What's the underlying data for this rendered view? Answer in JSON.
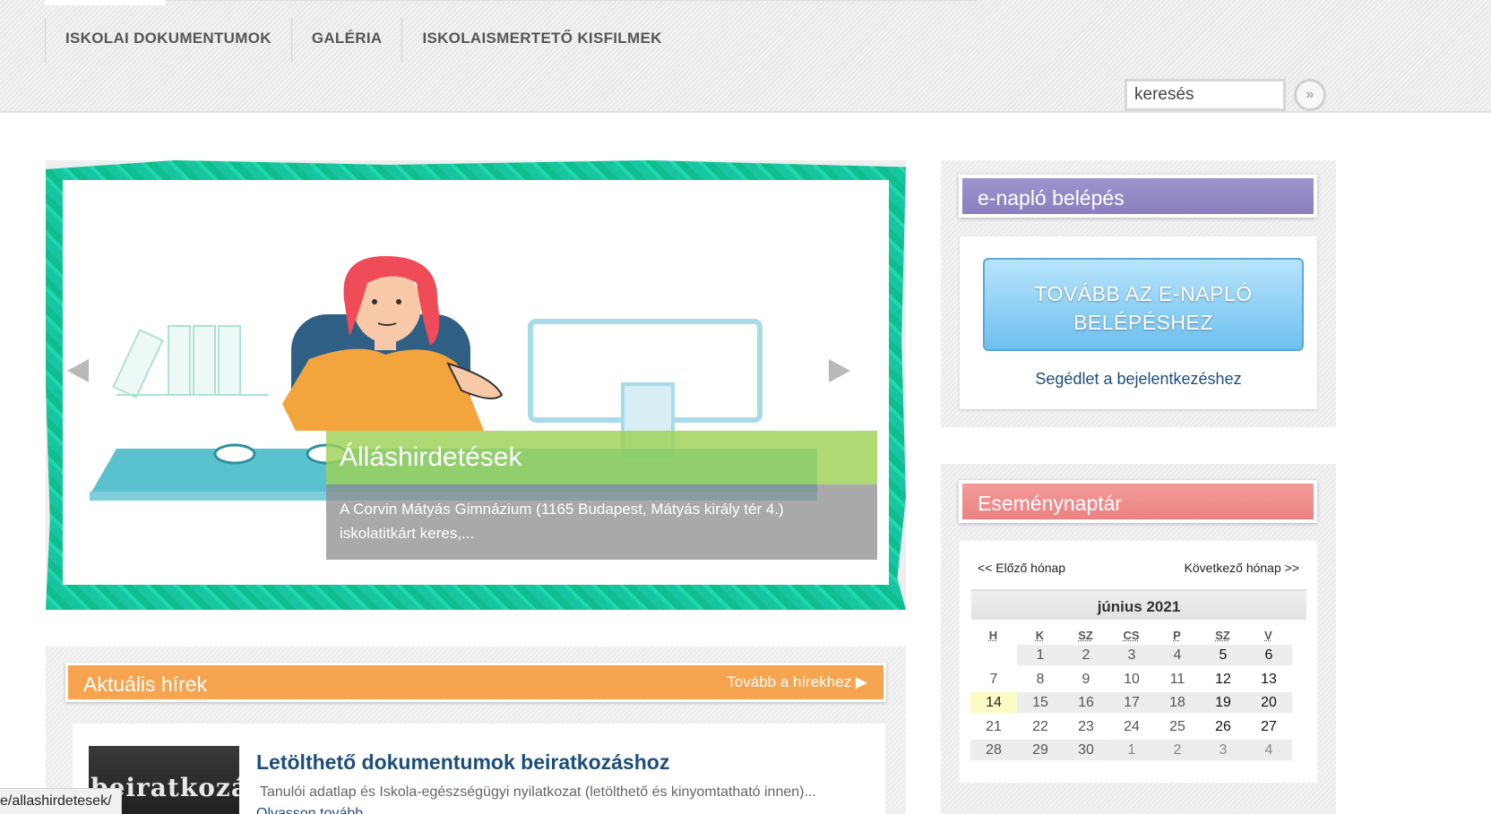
{
  "nav": {
    "items": [
      "ISKOLAI DOKUMENTUMOK",
      "GALÉRIA",
      "ISKOLAISMERTETŐ KISFILMEK"
    ]
  },
  "search": {
    "value": "keresés",
    "button_icon": "double-chevron-right-icon",
    "button_glyph": "»"
  },
  "slider": {
    "caption_title": "Álláshirdetések",
    "caption_text": "A Corvin Mátyás Gimnázium (1165 Budapest, Mátyás király tér 4.) iskolatitkárt keres,...",
    "colors": {
      "border": "#17c6a0",
      "title_bg": "#9ed156",
      "text_bg": "#8c8c8c"
    }
  },
  "news": {
    "header_title": "Aktuális hírek",
    "header_more": "Tovább a hírekhez ▶",
    "item": {
      "thumb_text": "beiratkozás",
      "title": "Letölthető dokumentumok beiratkozáshoz",
      "text": "Tanulói adatlap és Iskola-egészségügyi nyilatkozat (letölthető és kinyomtatható innen)...",
      "more": "Olvasson tovább"
    },
    "accent": "#f6a44f"
  },
  "enaplo": {
    "header": "e-napló belépés",
    "button_line1": "TOVÁBB AZ E-NAPLÓ",
    "button_line2": "BELÉPÉSHEZ",
    "help_link": "Segédlet a bejelentkezéshez",
    "accent": "#8b7ec0"
  },
  "calendar": {
    "header": "Eseménynaptár",
    "prev": "<< Előző hónap",
    "next": "Következő hónap >>",
    "month": "június 2021",
    "days_of_week": [
      "H",
      "K",
      "SZ",
      "CS",
      "P",
      "SZ",
      "V"
    ],
    "weeks": [
      [
        "",
        "1",
        "2",
        "3",
        "4",
        "5",
        "6"
      ],
      [
        "7",
        "8",
        "9",
        "10",
        "11",
        "12",
        "13"
      ],
      [
        "14",
        "15",
        "16",
        "17",
        "18",
        "19",
        "20"
      ],
      [
        "21",
        "22",
        "23",
        "24",
        "25",
        "26",
        "27"
      ],
      [
        "28",
        "29",
        "30",
        "1",
        "2",
        "3",
        "4"
      ]
    ],
    "today": "14",
    "accent": "#ec8282"
  },
  "status_bar": {
    "url": "e/allashirdetesek/"
  }
}
